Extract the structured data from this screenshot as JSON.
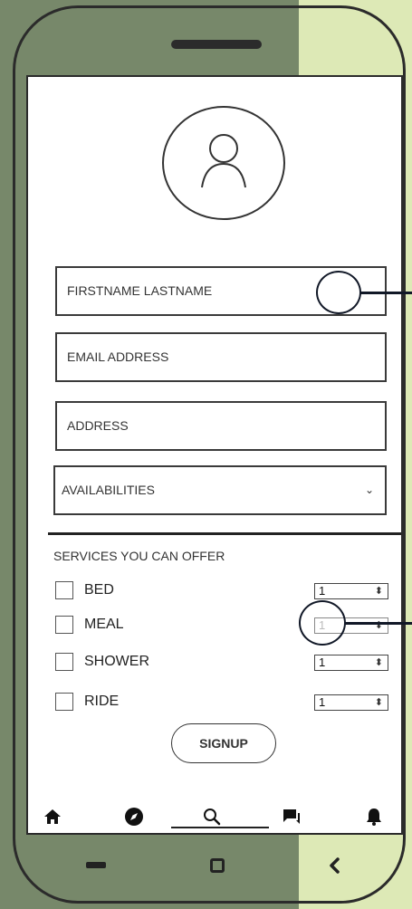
{
  "form": {
    "name_placeholder": "FIRSTNAME LASTNAME",
    "email_placeholder": "EMAIL ADDRESS",
    "address_placeholder": "ADDRESS",
    "availabilities_label": "AVAILABILITIES",
    "availabilities_arrow": "⌄"
  },
  "services": {
    "title": "SERVICES YOU CAN OFFER",
    "items": [
      {
        "label": "BED",
        "qty": "1",
        "checked": false,
        "disabled": false
      },
      {
        "label": "MEAL",
        "qty": "1",
        "checked": false,
        "disabled": true
      },
      {
        "label": "SHOWER",
        "qty": "1",
        "checked": false,
        "disabled": false
      },
      {
        "label": "RIDE",
        "qty": "1",
        "checked": false,
        "disabled": false
      }
    ],
    "stepper_arrows": "⬍"
  },
  "signup_label": "SIGNUP",
  "tabs": [
    {
      "name": "home-icon",
      "active": false
    },
    {
      "name": "compass-icon",
      "active": false
    },
    {
      "name": "search-icon",
      "active": true
    },
    {
      "name": "chat-icon",
      "active": false
    },
    {
      "name": "bell-icon",
      "active": false
    }
  ],
  "hardware_buttons": [
    "recent-apps",
    "home",
    "back"
  ],
  "colors": {
    "background_left": "#77886a",
    "background_right": "#dde9b6",
    "callout": "#111827"
  }
}
